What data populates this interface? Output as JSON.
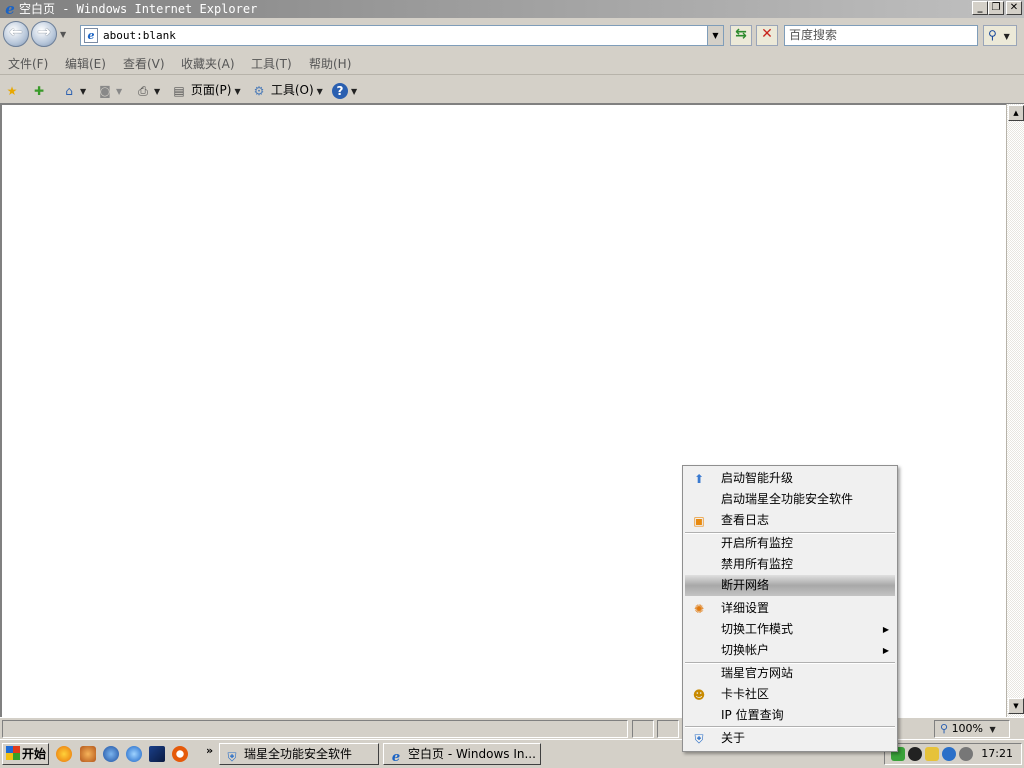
{
  "window": {
    "title": "空白页 - Windows Internet Explorer",
    "minimize": "_",
    "maximize": "❐",
    "close": "✕"
  },
  "address": {
    "value": "about:blank"
  },
  "search": {
    "placeholder": "百度搜索"
  },
  "menubar": {
    "items": [
      "文件(F)",
      "编辑(E)",
      "查看(V)",
      "收藏夹(A)",
      "工具(T)",
      "帮助(H)"
    ]
  },
  "commandbar": {
    "page_label": "页面(P)",
    "tools_label": "工具(O)"
  },
  "statusbar": {
    "zoom": "100%"
  },
  "taskbar": {
    "start_label": "开始",
    "items": [
      "瑞星全功能安全软件",
      "空白页 - Windows In..."
    ],
    "clock": "17:21"
  },
  "context_menu": {
    "items": [
      "启动智能升级",
      "启动瑞星全功能安全软件",
      "查看日志",
      "开启所有监控",
      "禁用所有监控",
      "断开网络",
      "详细设置",
      "切换工作模式",
      "切换帐户",
      "瑞星官方网站",
      "卡卡社区",
      "IP 位置查询",
      "关于"
    ]
  },
  "icons": {
    "ie": "internet-explorer-icon",
    "back": "back-arrow-icon",
    "forward": "forward-arrow-icon",
    "refresh": "refresh-icon",
    "stop": "stop-icon",
    "search": "magnifier-icon",
    "favorites": "star-icon",
    "add_favorite": "add-favorite-icon",
    "home": "home-icon",
    "feeds": "rss-icon",
    "print": "printer-icon",
    "page": "page-icon",
    "tools": "gear-icon",
    "help": "help-icon"
  },
  "colors": {
    "titlebar_inactive": "#808080",
    "menu_highlight": "#a8a8a8",
    "ie_blue": "#1a63c5"
  }
}
